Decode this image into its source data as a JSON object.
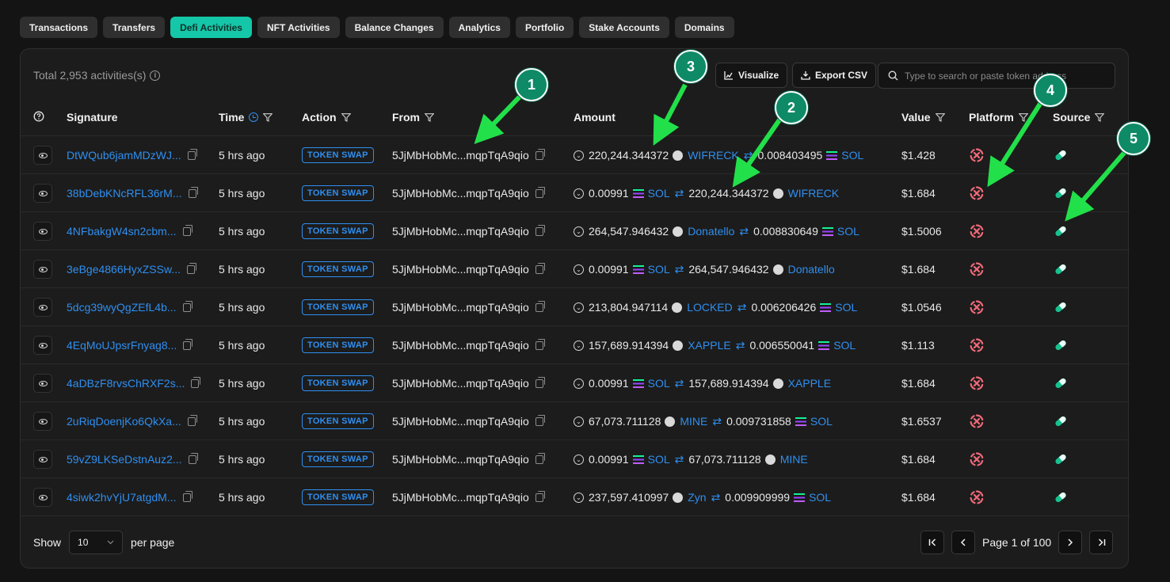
{
  "tabs": [
    {
      "label": "Transactions",
      "active": false
    },
    {
      "label": "Transfers",
      "active": false
    },
    {
      "label": "Defi Activities",
      "active": true
    },
    {
      "label": "NFT Activities",
      "active": false
    },
    {
      "label": "Balance Changes",
      "active": false
    },
    {
      "label": "Analytics",
      "active": false
    },
    {
      "label": "Portfolio",
      "active": false
    },
    {
      "label": "Stake Accounts",
      "active": false
    },
    {
      "label": "Domains",
      "active": false
    }
  ],
  "panel": {
    "total_text": "Total 2,953 activities(s)",
    "visualize_label": "Visualize",
    "export_label": "Export CSV",
    "search_placeholder": "Type to search or paste token address"
  },
  "columns": {
    "signature": "Signature",
    "time": "Time",
    "action": "Action",
    "from": "From",
    "amount": "Amount",
    "value": "Value",
    "platform": "Platform",
    "source": "Source"
  },
  "rows": [
    {
      "signature": "DtWQub6jamMDzWJ...",
      "time": "5 hrs ago",
      "action": "TOKEN SWAP",
      "from": "5JjMbHobMc...mqpTqA9qio",
      "in_amount": "220,244.344372",
      "in_token": "WIFRECK",
      "in_sol": false,
      "out_amount": "0.008403495",
      "out_token": "SOL",
      "out_sol": true,
      "value": "$1.428"
    },
    {
      "signature": "38bDebKNcRFL36rM...",
      "time": "5 hrs ago",
      "action": "TOKEN SWAP",
      "from": "5JjMbHobMc...mqpTqA9qio",
      "in_amount": "0.00991",
      "in_token": "SOL",
      "in_sol": true,
      "out_amount": "220,244.344372",
      "out_token": "WIFRECK",
      "out_sol": false,
      "value": "$1.684"
    },
    {
      "signature": "4NFbakgW4sn2cbm...",
      "time": "5 hrs ago",
      "action": "TOKEN SWAP",
      "from": "5JjMbHobMc...mqpTqA9qio",
      "in_amount": "264,547.946432",
      "in_token": "Donatello",
      "in_sol": false,
      "out_amount": "0.008830649",
      "out_token": "SOL",
      "out_sol": true,
      "value": "$1.5006"
    },
    {
      "signature": "3eBge4866HyxZSSw...",
      "time": "5 hrs ago",
      "action": "TOKEN SWAP",
      "from": "5JjMbHobMc...mqpTqA9qio",
      "in_amount": "0.00991",
      "in_token": "SOL",
      "in_sol": true,
      "out_amount": "264,547.946432",
      "out_token": "Donatello",
      "out_sol": false,
      "value": "$1.684"
    },
    {
      "signature": "5dcg39wyQgZEfL4b...",
      "time": "5 hrs ago",
      "action": "TOKEN SWAP",
      "from": "5JjMbHobMc...mqpTqA9qio",
      "in_amount": "213,804.947114",
      "in_token": "LOCKED",
      "in_sol": false,
      "out_amount": "0.006206426",
      "out_token": "SOL",
      "out_sol": true,
      "value": "$1.0546"
    },
    {
      "signature": "4EqMoUJpsrFnyag8...",
      "time": "5 hrs ago",
      "action": "TOKEN SWAP",
      "from": "5JjMbHobMc...mqpTqA9qio",
      "in_amount": "157,689.914394",
      "in_token": "XAPPLE",
      "in_sol": false,
      "out_amount": "0.006550041",
      "out_token": "SOL",
      "out_sol": true,
      "value": "$1.113"
    },
    {
      "signature": "4aDBzF8rvsChRXF2s...",
      "time": "5 hrs ago",
      "action": "TOKEN SWAP",
      "from": "5JjMbHobMc...mqpTqA9qio",
      "in_amount": "0.00991",
      "in_token": "SOL",
      "in_sol": true,
      "out_amount": "157,689.914394",
      "out_token": "XAPPLE",
      "out_sol": false,
      "value": "$1.684"
    },
    {
      "signature": "2uRiqDoenjKo6QkXa...",
      "time": "5 hrs ago",
      "action": "TOKEN SWAP",
      "from": "5JjMbHobMc...mqpTqA9qio",
      "in_amount": "67,073.711128",
      "in_token": "MINE",
      "in_sol": false,
      "out_amount": "0.009731858",
      "out_token": "SOL",
      "out_sol": true,
      "value": "$1.6537"
    },
    {
      "signature": "59vZ9LKSeDstnAuz2...",
      "time": "5 hrs ago",
      "action": "TOKEN SWAP",
      "from": "5JjMbHobMc...mqpTqA9qio",
      "in_amount": "0.00991",
      "in_token": "SOL",
      "in_sol": true,
      "out_amount": "67,073.711128",
      "out_token": "MINE",
      "out_sol": false,
      "value": "$1.684"
    },
    {
      "signature": "4siwk2hvYjU7atgdM...",
      "time": "5 hrs ago",
      "action": "TOKEN SWAP",
      "from": "5JjMbHobMc...mqpTqA9qio",
      "in_amount": "237,597.410997",
      "in_token": "Zyn",
      "in_sol": false,
      "out_amount": "0.009909999",
      "out_token": "SOL",
      "out_sol": true,
      "value": "$1.684"
    }
  ],
  "footer": {
    "show_label": "Show",
    "page_size": "10",
    "per_page_label": "per page",
    "page_text": "Page 1 of 100"
  },
  "callouts": [
    "1",
    "2",
    "3",
    "4",
    "5"
  ],
  "colors": {
    "accent": "#14c7a8",
    "link": "#2f8ff0",
    "callout": "#0e8a67",
    "arrow": "#22e04a",
    "platform": "#f06a7a",
    "source": "#16c28f"
  }
}
